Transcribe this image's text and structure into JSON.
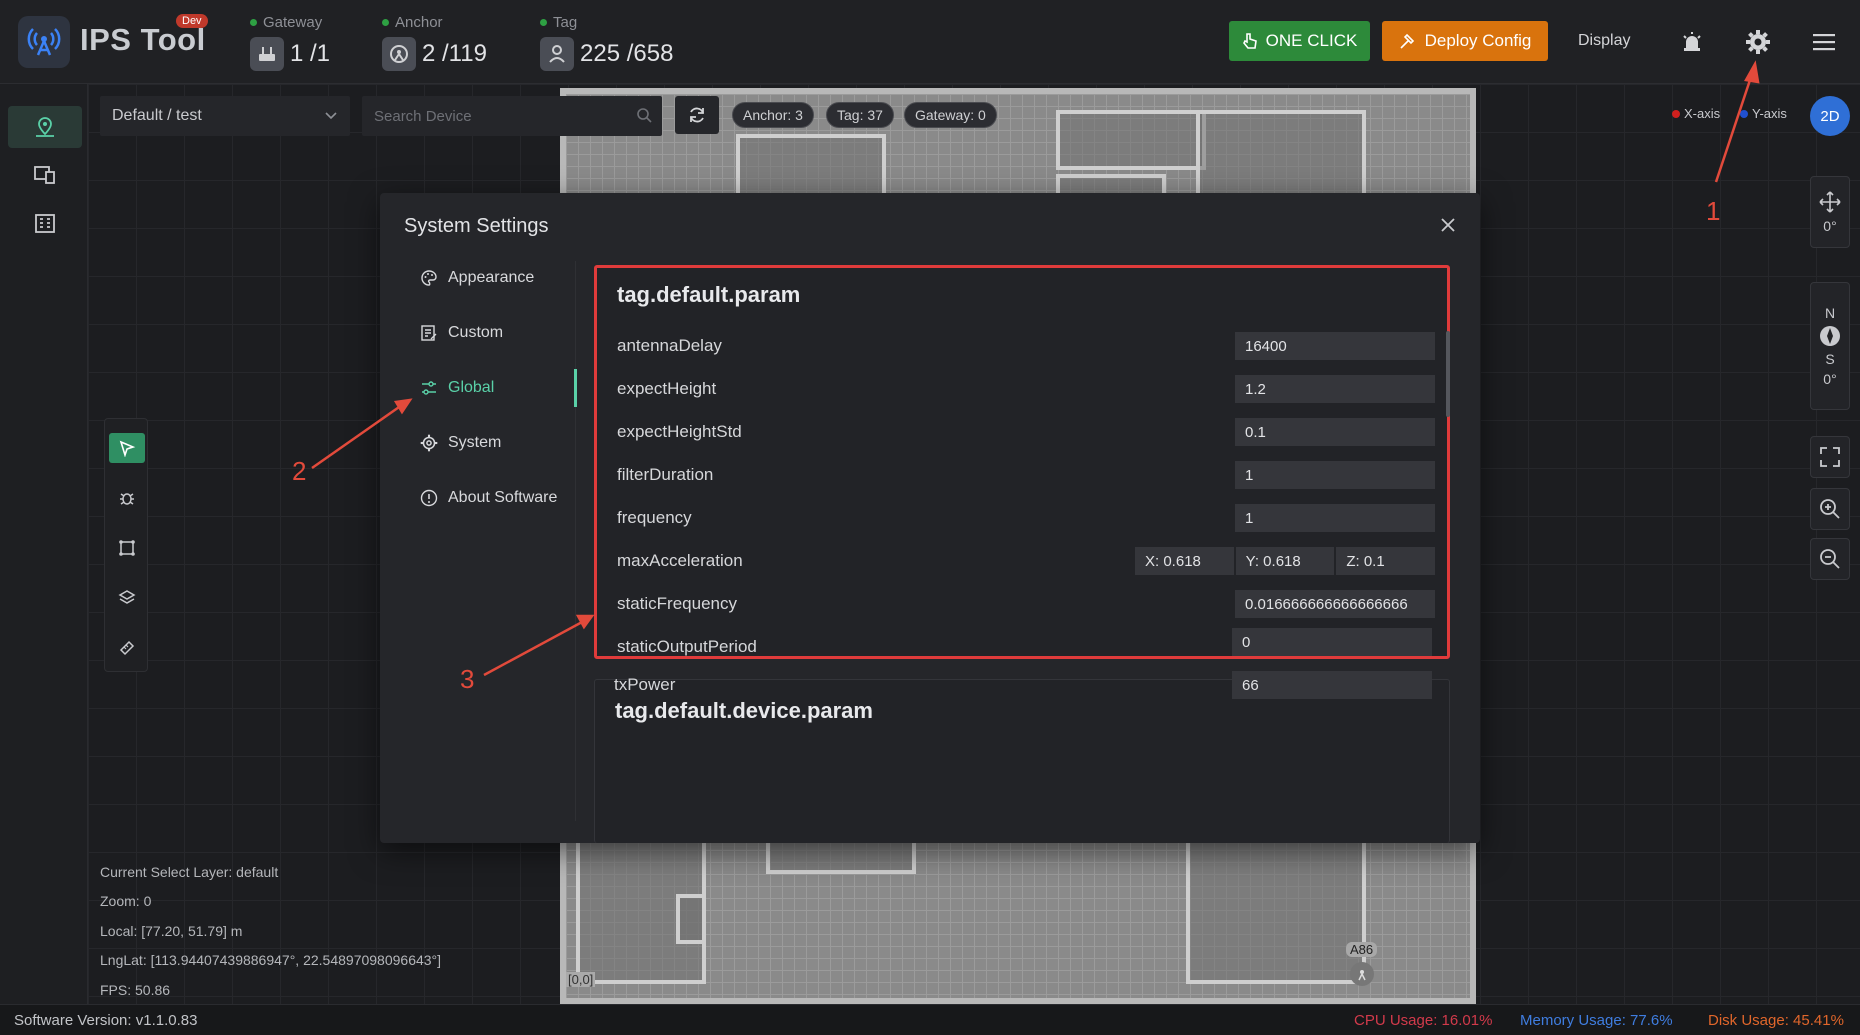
{
  "app": {
    "title": "IPS Tool",
    "badge": "Dev"
  },
  "stats": {
    "gateway": {
      "label": "Gateway",
      "value": "1 /1"
    },
    "anchor": {
      "label": "Anchor",
      "value": "2 /119"
    },
    "tag": {
      "label": "Tag",
      "value": "225 /658"
    }
  },
  "toolbar": {
    "one_click": "ONE CLICK",
    "deploy": "Deploy Config",
    "display": "Display"
  },
  "map": {
    "layer_select": "Default / test",
    "search_placeholder": "Search Device",
    "counts": {
      "anchor": "Anchor: 3",
      "tag": "Tag: 37",
      "gateway": "Gateway: 0"
    },
    "x_axis": "X-axis",
    "y_axis": "Y-axis",
    "view_mode": "2D",
    "rotation_1": "0°",
    "compass_n": "N",
    "compass_s": "S",
    "rotation_2": "0°",
    "origin_label": "[0,0]",
    "anchor_label": "A86"
  },
  "info": {
    "layer": "Current Select Layer:  default",
    "zoom": "Zoom:  0",
    "local": "Local:  [77.20, 51.79] m",
    "lnglat": "LngLat:  [113.94407439886947°, 22.54897098096643°]",
    "fps": "FPS:  50.86"
  },
  "status": {
    "version": "Software Version:  v1.1.0.83",
    "cpu": "CPU Usage:  16.01%",
    "memory": "Memory Usage:  77.6%",
    "disk": "Disk Usage:  45.41%"
  },
  "modal": {
    "title": "System Settings",
    "menu": [
      {
        "label": "Appearance",
        "icon": "palette-icon"
      },
      {
        "label": "Custom",
        "icon": "edit-list-icon"
      },
      {
        "label": "Global",
        "icon": "sliders-icon",
        "active": true
      },
      {
        "label": "System",
        "icon": "gear-icon"
      },
      {
        "label": "About Software",
        "icon": "info-icon"
      }
    ],
    "section1": {
      "title": "tag.default.param",
      "params": [
        {
          "label": "antennaDelay",
          "value": "16400"
        },
        {
          "label": "expectHeight",
          "value": "1.2"
        },
        {
          "label": "expectHeightStd",
          "value": "0.1"
        },
        {
          "label": "filterDuration",
          "value": "1"
        },
        {
          "label": "frequency",
          "value": "1"
        },
        {
          "label": "maxAcceleration",
          "x": "X: 0.618",
          "y": "Y: 0.618",
          "z": "Z: 0.1"
        },
        {
          "label": "staticFrequency",
          "value": "0.016666666666666666"
        },
        {
          "label": "staticOutputPeriod",
          "value": "0"
        },
        {
          "label": "txPower",
          "value": "66"
        }
      ]
    },
    "section2": {
      "title": "tag.default.device.param"
    }
  },
  "annotations": {
    "one": "1",
    "two": "2",
    "three": "3"
  },
  "colors": {
    "accent": "#5ad1a8",
    "highlight": "#e03b3b",
    "one_click": "#2d8a3a",
    "deploy": "#d9730d"
  }
}
